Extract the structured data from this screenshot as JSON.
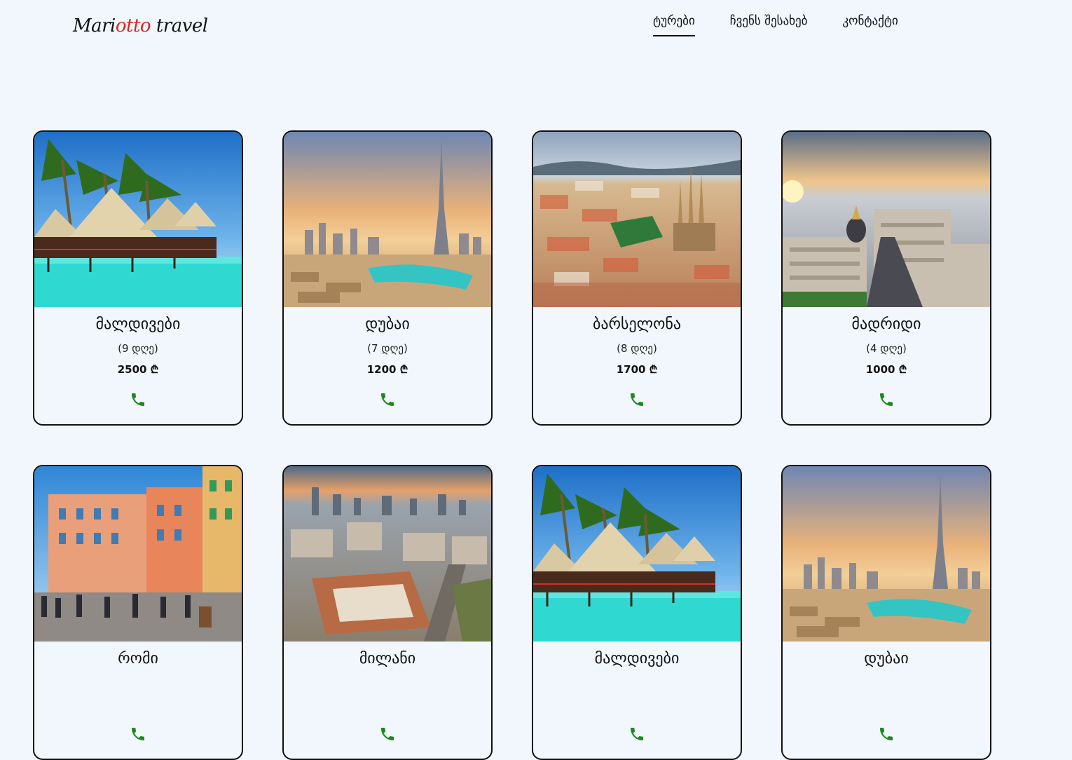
{
  "header": {
    "logo_part1": "Mari",
    "logo_accent": "otto",
    "logo_part2": " travel",
    "nav": [
      {
        "label": "ტურები",
        "active": true
      },
      {
        "label": "ჩვენს შესახებ",
        "active": false
      },
      {
        "label": "კონტაქტი",
        "active": false
      }
    ]
  },
  "colors": {
    "background": "#f1f7fd",
    "logo_accent": "#e0231d",
    "phone_icon": "#1a8a1a"
  },
  "tours": [
    {
      "name": "მალდივები",
      "days": "(9 დღე)",
      "price": "2500 ₾",
      "image": "maldives"
    },
    {
      "name": "დუბაი",
      "days": "(7 დღე)",
      "price": "1200 ₾",
      "image": "dubai"
    },
    {
      "name": "ბარსელონა",
      "days": "(8 დღე)",
      "price": "1700 ₾",
      "image": "barcelona"
    },
    {
      "name": "მადრიდი",
      "days": "(4 დღე)",
      "price": "1000 ₾",
      "image": "madrid"
    },
    {
      "name": "რომი",
      "days": "",
      "price": "",
      "image": "rome"
    },
    {
      "name": "მილანი",
      "days": "",
      "price": "",
      "image": "milan"
    },
    {
      "name": "მალდივები",
      "days": "",
      "price": "",
      "image": "maldives"
    },
    {
      "name": "დუბაი",
      "days": "",
      "price": "",
      "image": "dubai"
    }
  ],
  "icons": {
    "phone": "phone-icon"
  }
}
